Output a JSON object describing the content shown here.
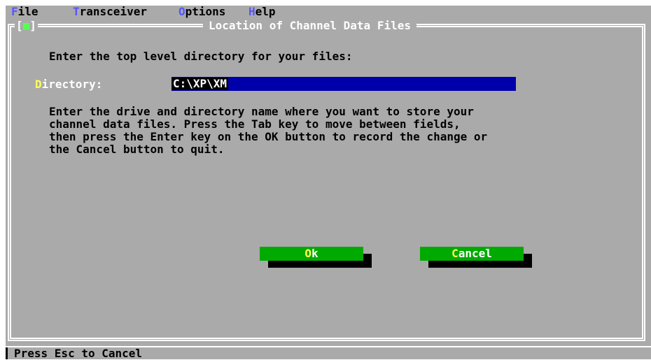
{
  "menu": {
    "file": {
      "hotkey": "F",
      "rest": "ile"
    },
    "transceiver": {
      "hotkey": "T",
      "rest": "ransceiver"
    },
    "options": {
      "hotkey": "O",
      "rest": "ptions"
    },
    "help": {
      "hotkey": "H",
      "rest": "elp"
    }
  },
  "window": {
    "close_box": {
      "left": "[",
      "dot": "■",
      "right": "]"
    },
    "title": "Location of Channel Data Files"
  },
  "form": {
    "prompt": "Enter the top level directory for your files:",
    "directory_label": {
      "hotkey": "D",
      "rest": "irectory:"
    },
    "directory_value": "C:\\XP\\XM",
    "help_lines": [
      "Enter the drive and directory name where you want to store your",
      "channel data files. Press the Tab key to move between fields,",
      "then press the Enter key on the OK button to record the change or",
      "the Cancel button to quit."
    ]
  },
  "buttons": {
    "ok": {
      "hotkey": "O",
      "rest": "k"
    },
    "cancel": {
      "hotkey": "C",
      "rest": "ancel"
    }
  },
  "status_bar": {
    "text": "Press Esc to Cancel"
  },
  "colors": {
    "background": "#aaaaaa",
    "field": "#0000aa",
    "button": "#00aa00",
    "hotkey_menu": "#5555ff",
    "hotkey_label": "#ffff55"
  }
}
